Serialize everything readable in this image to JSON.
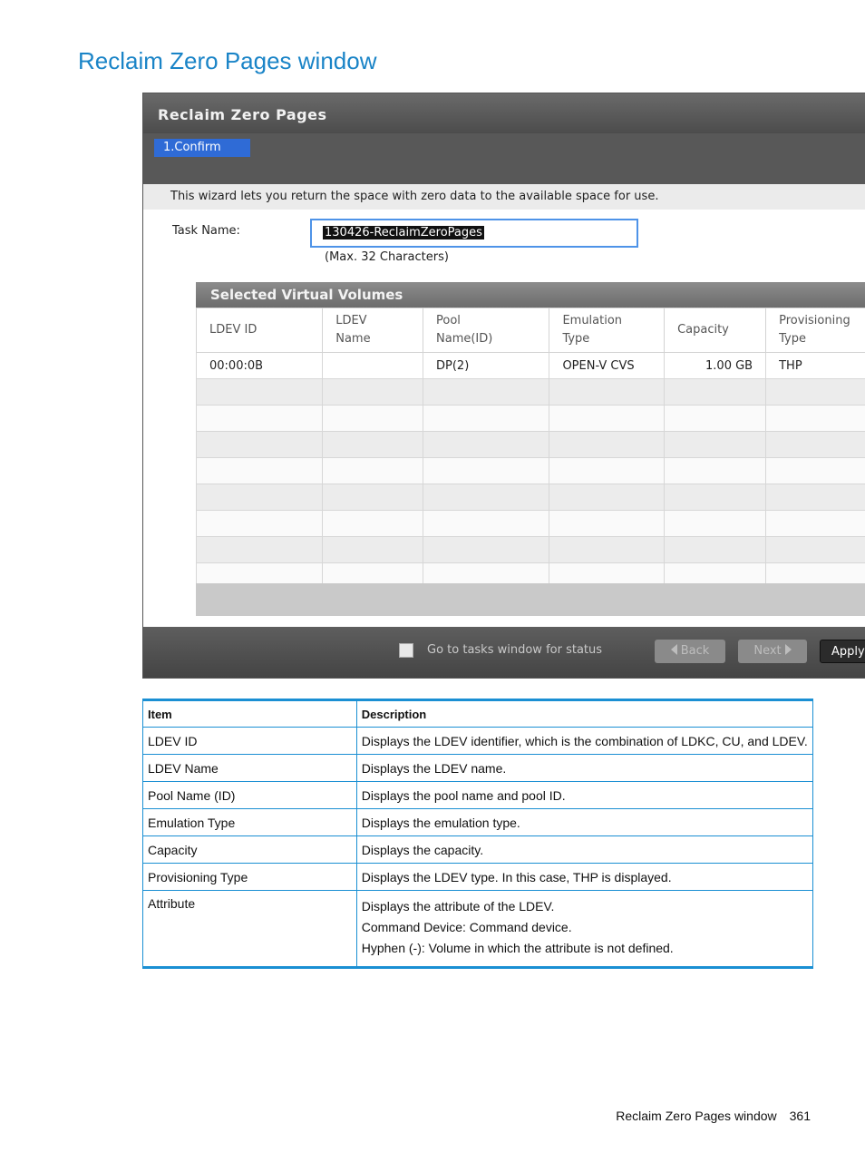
{
  "page": {
    "title": "Reclaim Zero Pages window",
    "footer_label": "Reclaim Zero Pages window",
    "page_number": "361"
  },
  "dialog": {
    "title": "Reclaim Zero Pages",
    "step": "1.Confirm",
    "description": "This wizard lets you return the space with zero data to the available space for use.",
    "task_name_label": "Task Name:",
    "task_name_value": "130426-ReclaimZeroPages",
    "task_name_hint": "(Max. 32 Characters)",
    "volumes_header": "Selected Virtual Volumes",
    "columns": [
      "LDEV ID",
      "LDEV\nName",
      "Pool\nName(ID)",
      "Emulation\nType",
      "Capacity",
      "Provisioning\nType"
    ],
    "rows": [
      [
        "00:00:0B",
        "",
        "DP(2)",
        "OPEN-V CVS",
        "1.00 GB",
        "THP"
      ]
    ],
    "go_to_tasks_label": "Go to tasks window for status",
    "back_label": "Back",
    "next_label": "Next",
    "apply_label": "Apply"
  },
  "desc_table": {
    "headers": [
      "Item",
      "Description"
    ],
    "rows": [
      {
        "item": "LDEV ID",
        "desc": [
          "Displays the LDEV identifier, which is the combination of LDKC, CU, and LDEV."
        ]
      },
      {
        "item": "LDEV Name",
        "desc": [
          "Displays the LDEV name."
        ]
      },
      {
        "item": "Pool Name (ID)",
        "desc": [
          "Displays the pool name and pool ID."
        ]
      },
      {
        "item": "Emulation Type",
        "desc": [
          "Displays the emulation type."
        ]
      },
      {
        "item": "Capacity",
        "desc": [
          "Displays the capacity."
        ]
      },
      {
        "item": "Provisioning Type",
        "desc": [
          "Displays the LDEV type. In this case, THP is displayed."
        ]
      },
      {
        "item": "Attribute",
        "desc": [
          "Displays the attribute of the LDEV.",
          "Command Device: Command device.",
          "Hyphen (-): Volume in which the attribute is not defined."
        ]
      }
    ]
  },
  "colors": {
    "title_blue": "#1a84c7",
    "table_rule_blue": "#1a8fd3",
    "step_pill": "#2f6bd6",
    "input_border": "#4e93e8"
  }
}
